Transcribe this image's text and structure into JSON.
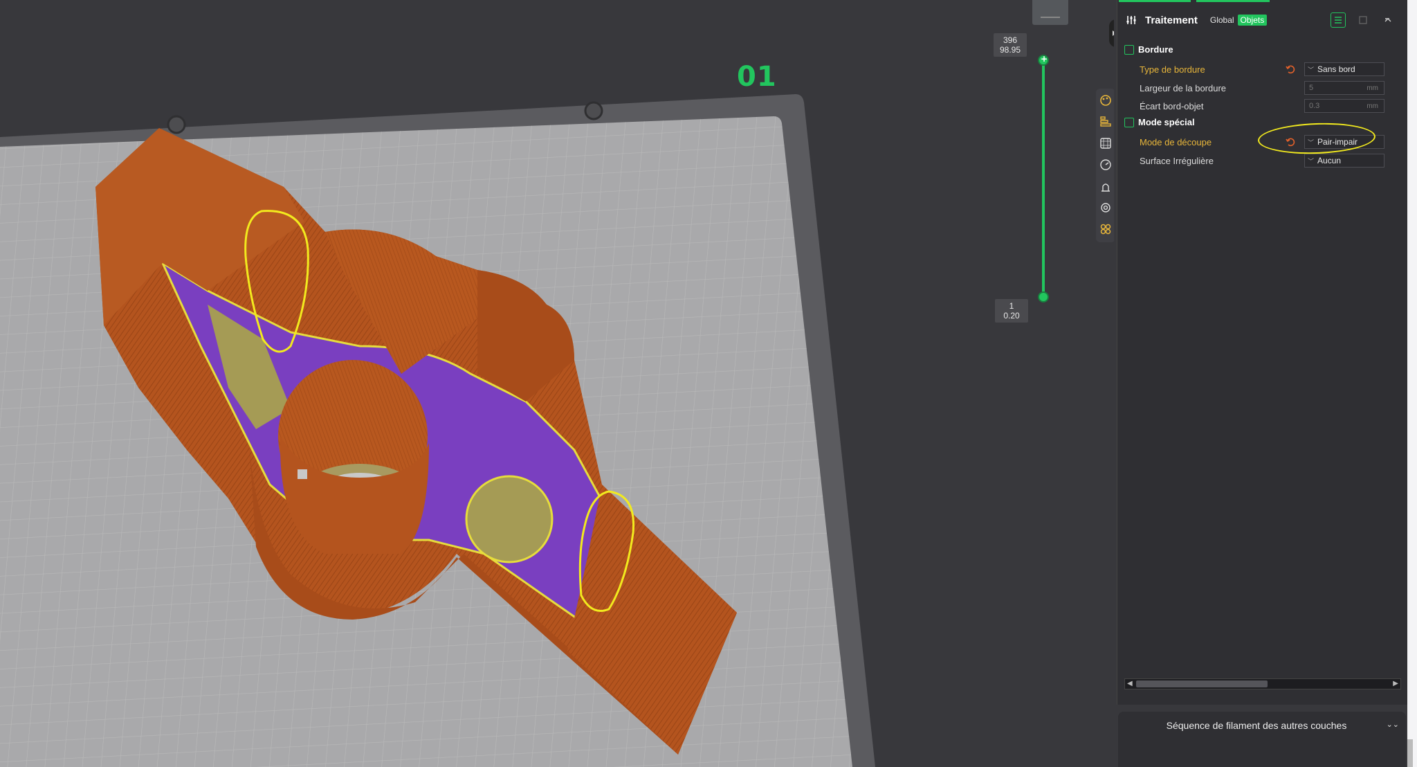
{
  "viewport": {
    "plate_label": "01",
    "layer_slider": {
      "top_layer": "396",
      "top_height": "98.95",
      "bottom_layer": "1",
      "bottom_height": "0.20"
    },
    "toolbar_icons": [
      "preview-color-icon",
      "layers-icon",
      "grid-infill-icon",
      "speed-icon",
      "support-icon",
      "settings-gear-icon",
      "multicolor-icon"
    ]
  },
  "panel": {
    "title": "Traitement",
    "tab_global": "Global",
    "tab_objets": "Objets",
    "sections": [
      {
        "title": "Bordure",
        "rows": [
          {
            "label": "Type de bordure",
            "value": "Sans bord",
            "kind": "combo",
            "modified": true
          },
          {
            "label": "Largeur de la bordure",
            "value": "5",
            "unit": "mm",
            "kind": "number"
          },
          {
            "label": "Écart bord-objet",
            "value": "0.3",
            "unit": "mm",
            "kind": "number"
          }
        ]
      },
      {
        "title": "Mode spécial",
        "rows": [
          {
            "label": "Mode de découpe",
            "value": "Pair-impair",
            "kind": "combo",
            "modified": true
          },
          {
            "label": "Surface Irrégulière",
            "value": "Aucun",
            "kind": "combo"
          }
        ]
      }
    ]
  },
  "filament_sequence": {
    "label": "Séquence de filament des autres couches"
  },
  "colors": {
    "accent": "#22c55e",
    "model_orange": "#b4541e",
    "infill_purple": "#7a3fc0",
    "highlight_yellow": "#f2ea1e",
    "modified_label": "#e8b63a"
  }
}
